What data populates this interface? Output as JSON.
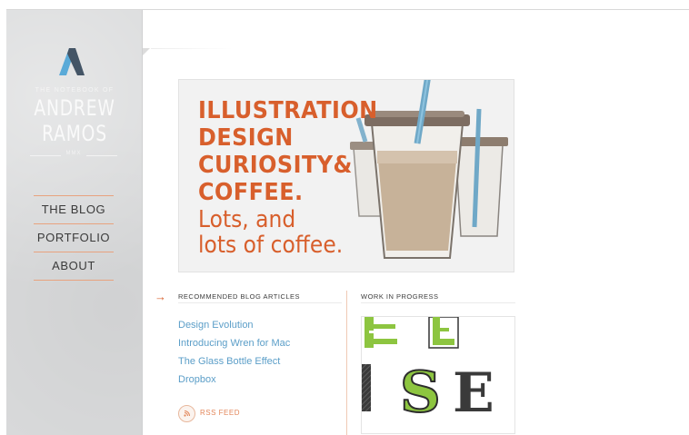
{
  "sidebar": {
    "tagline": "THE NOTEBOOK OF",
    "name_first": "ANDREW",
    "name_last": "RAMOS",
    "year": "MMX",
    "nav": [
      {
        "label": "THE BLOG"
      },
      {
        "label": "PORTFOLIO"
      },
      {
        "label": "ABOUT"
      }
    ]
  },
  "hero": {
    "line1": "ILLUSTRATION",
    "line2": "DESIGN",
    "line3": "CURIOSITY&",
    "line4": "COFFEE.",
    "line5": "Lots, and",
    "line6": "lots of coffee."
  },
  "blog": {
    "heading": "RECOMMENDED BLOG ARTICLES",
    "articles": [
      {
        "title": "Design Evolution"
      },
      {
        "title": "Introducing Wren for Mac"
      },
      {
        "title": "The Glass Bottle Effect"
      },
      {
        "title": "Dropbox"
      }
    ],
    "rss_label": "RSS FEED"
  },
  "wip": {
    "heading": "WORK IN PROGRESS",
    "letters": [
      "E",
      "E",
      "I",
      "S",
      "E"
    ]
  },
  "colors": {
    "accent": "#d85f2c",
    "link": "#5b9ec8",
    "sidebar_bg": "#d9dadb",
    "logo_blue": "#5aaad8",
    "logo_dark": "#445566",
    "lettering_green": "#8dc540"
  },
  "icons": [
    "logo-a-icon",
    "arrow-right-icon",
    "rss-icon"
  ]
}
